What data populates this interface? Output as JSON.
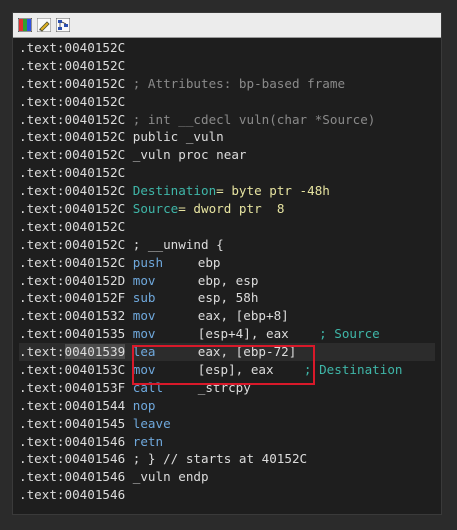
{
  "toolbar": {
    "icons": [
      "palette-icon",
      "pencil-icon",
      "graph-icon"
    ]
  },
  "lines": [
    {
      "addr": ".text:0040152C",
      "body": ""
    },
    {
      "addr": ".text:0040152C",
      "body": ""
    },
    {
      "addr": ".text:0040152C",
      "comment": "; Attributes: bp-based frame"
    },
    {
      "addr": ".text:0040152C",
      "body": ""
    },
    {
      "addr": ".text:0040152C",
      "comment": "; int __cdecl vuln(char *Source)"
    },
    {
      "addr": ".text:0040152C",
      "text": "public _vuln"
    },
    {
      "addr": ".text:0040152C",
      "text": "_vuln proc near"
    },
    {
      "addr": ".text:0040152C",
      "body": ""
    },
    {
      "addr": ".text:0040152C",
      "var": "Destination",
      "vardef": "= byte ptr -48h"
    },
    {
      "addr": ".text:0040152C",
      "var": "Source",
      "vardef": "= dword ptr  8"
    },
    {
      "addr": ".text:0040152C",
      "body": ""
    },
    {
      "addr": ".text:0040152C",
      "text": "; __unwind {"
    },
    {
      "addr": ".text:0040152C",
      "mn": "push",
      "ops": "ebp"
    },
    {
      "addr": ".text:0040152D",
      "mn": "mov",
      "ops": "ebp, esp"
    },
    {
      "addr": ".text:0040152F",
      "mn": "sub",
      "ops": "esp, 58h"
    },
    {
      "addr": ".text:00401532",
      "mn": "mov",
      "ops": "eax, [ebp+8]"
    },
    {
      "addr": ".text:00401535",
      "mn": "mov",
      "ops": "[esp+4], eax",
      "cmt": "; Source"
    },
    {
      "addr": ".text:00401539",
      "mn": "lea",
      "ops": "eax, [ebp-72]",
      "current": true
    },
    {
      "addr": ".text:0040153C",
      "mn": "mov",
      "ops": "[esp], eax",
      "cmt": "; Destination"
    },
    {
      "addr": ".text:0040153F",
      "mn": "call",
      "ops": "_strcpy"
    },
    {
      "addr": ".text:00401544",
      "mn": "nop",
      "ops": ""
    },
    {
      "addr": ".text:00401545",
      "mn": "leave",
      "ops": ""
    },
    {
      "addr": ".text:00401546",
      "mn": "retn",
      "ops": ""
    },
    {
      "addr": ".text:00401546",
      "text": "; } // starts at 40152C"
    },
    {
      "addr": ".text:00401546",
      "text": "_vuln endp"
    },
    {
      "addr": ".text:00401546",
      "body": ""
    }
  ]
}
